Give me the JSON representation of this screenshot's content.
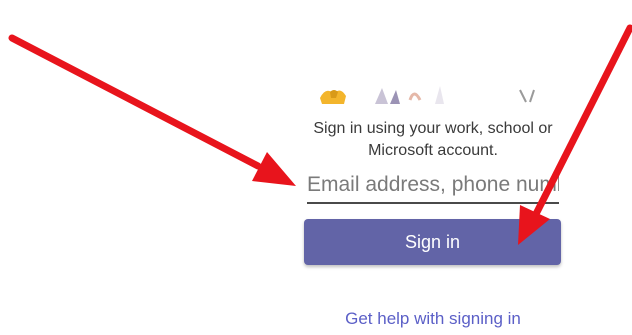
{
  "signin": {
    "prompt": "Sign in using your work, school or Microsoft account.",
    "email_placeholder": "Email address, phone number",
    "email_value": "",
    "button_label": "Sign in",
    "help_link": "Get help with signing in"
  },
  "colors": {
    "accent": "#6264a7",
    "link": "#5b5fc7",
    "annotation_arrow": "#e8141c"
  },
  "icons": {
    "illustration": "people-illustration",
    "arrows": [
      "red-arrow-icon",
      "red-arrow-icon"
    ]
  }
}
